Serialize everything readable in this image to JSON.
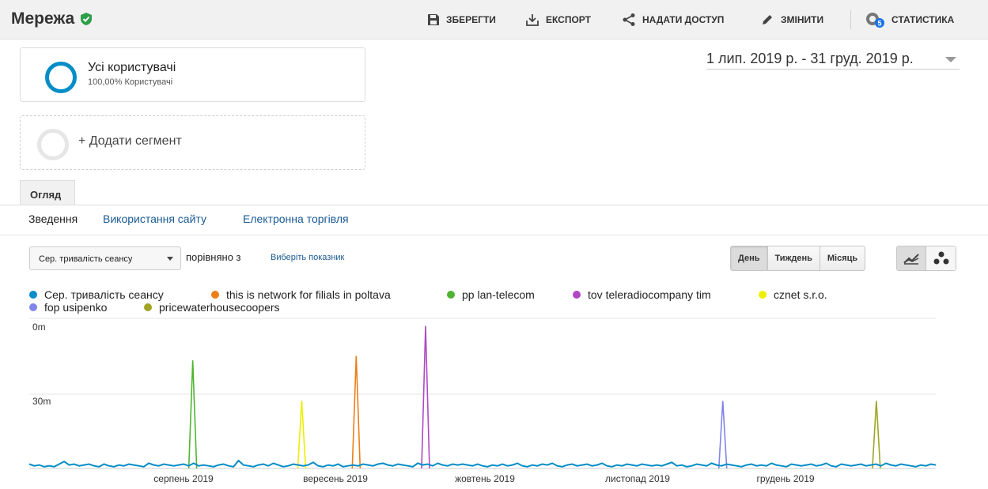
{
  "header": {
    "title": "Мережа",
    "actions": [
      {
        "label": "ЗБЕРЕГТИ",
        "icon": "save-icon"
      },
      {
        "label": "ЕКСПОРТ",
        "icon": "export-icon"
      },
      {
        "label": "НАДАТИ ДОСТУП",
        "icon": "share-icon"
      },
      {
        "label": "ЗМІНИТИ",
        "icon": "edit-icon"
      },
      {
        "label": "СТАТИСТИКА",
        "icon": "insights-icon",
        "badge": "5"
      }
    ]
  },
  "segments": {
    "active": {
      "name": "Усі користувачі",
      "sub": "100,00% Користувачі"
    },
    "add_label": "+ Додати сегмент"
  },
  "date_range": "1 лип. 2019 р. - 31 груд. 2019 р.",
  "tabs": {
    "overview": "Огляд"
  },
  "sub_tabs": [
    "Зведення",
    "Використання сайту",
    "Електронна торгівля"
  ],
  "controls": {
    "metric": "Сер. тривалість сеансу",
    "compare_label": "порівняно з",
    "choose_metric": "Виберіть показник",
    "granularity": [
      "День",
      "Тиждень",
      "Місяць"
    ],
    "active_granularity": "День"
  },
  "colors": {
    "accent": "#058dc7",
    "link": "#1a5a93",
    "verified": "#2e9e48"
  },
  "chart_data": {
    "type": "line",
    "y_ticks": [
      "0m",
      "30m"
    ],
    "x_labels": [
      "серпень 2019",
      "вересень 2019",
      "жовтень 2019",
      "листопад 2019",
      "грудень 2019"
    ],
    "x_range": [
      "2019-07-01",
      "2019-12-31"
    ],
    "series": [
      {
        "name": "Сер. тривалість сеансу",
        "color": "#058dc7",
        "values": [
          5,
          3,
          4,
          2,
          3,
          2,
          5,
          8,
          4,
          5,
          3,
          4,
          5,
          3,
          2,
          5,
          3,
          2,
          4,
          3,
          5,
          4,
          3,
          2,
          6,
          4,
          3,
          5,
          4,
          3,
          4,
          5,
          3,
          6,
          3,
          4,
          3,
          2,
          4,
          5,
          3,
          2,
          9,
          4,
          3,
          2,
          4,
          5,
          3,
          6,
          4,
          2,
          3,
          5,
          4,
          3,
          4,
          7,
          3,
          2,
          4,
          3,
          5,
          2,
          3,
          4,
          3,
          5,
          4,
          3,
          5,
          6,
          4,
          3,
          5,
          4,
          3,
          2,
          6,
          4,
          5,
          3,
          6,
          4,
          3,
          5,
          4,
          5,
          4,
          3,
          5,
          3,
          2,
          4,
          3,
          5,
          3,
          4,
          6,
          3,
          2,
          4,
          3,
          5,
          4,
          6,
          3,
          2,
          4,
          5,
          3,
          4,
          5,
          3,
          4,
          6,
          3,
          2,
          4,
          3,
          5,
          4,
          3,
          5,
          4,
          3,
          4,
          3,
          5,
          7,
          3,
          4,
          2,
          3,
          5,
          4,
          3,
          6,
          4,
          3,
          5,
          4,
          3,
          2,
          4,
          5,
          3,
          4,
          3,
          6,
          4,
          3,
          2,
          5,
          4,
          3,
          4,
          5,
          3,
          4,
          6,
          3,
          2,
          5,
          4,
          3,
          4,
          5,
          3,
          4,
          5,
          3,
          6,
          4,
          3,
          5,
          4,
          3,
          2,
          4,
          3,
          5,
          4
        ]
      },
      {
        "name": "this is network for filials in poltava",
        "color": "#ed7e17",
        "peak_date": "2019-09-05"
      },
      {
        "name": "pp lan-telecom",
        "color": "#50b432",
        "peak_date": "2019-08-03"
      },
      {
        "name": "tov teleradiocompany tim",
        "color": "#af49c5",
        "peak_date": "2019-09-19"
      },
      {
        "name": "cznet s.r.o.",
        "color": "#edef00",
        "peak_date": "2019-08-25"
      },
      {
        "name": "fop usipenko",
        "color": "#8085e8",
        "peak_date": "2019-11-18"
      },
      {
        "name": "pricewaterhousecoopers",
        "color": "#a0a424",
        "peak_date": "2019-12-19"
      }
    ]
  }
}
